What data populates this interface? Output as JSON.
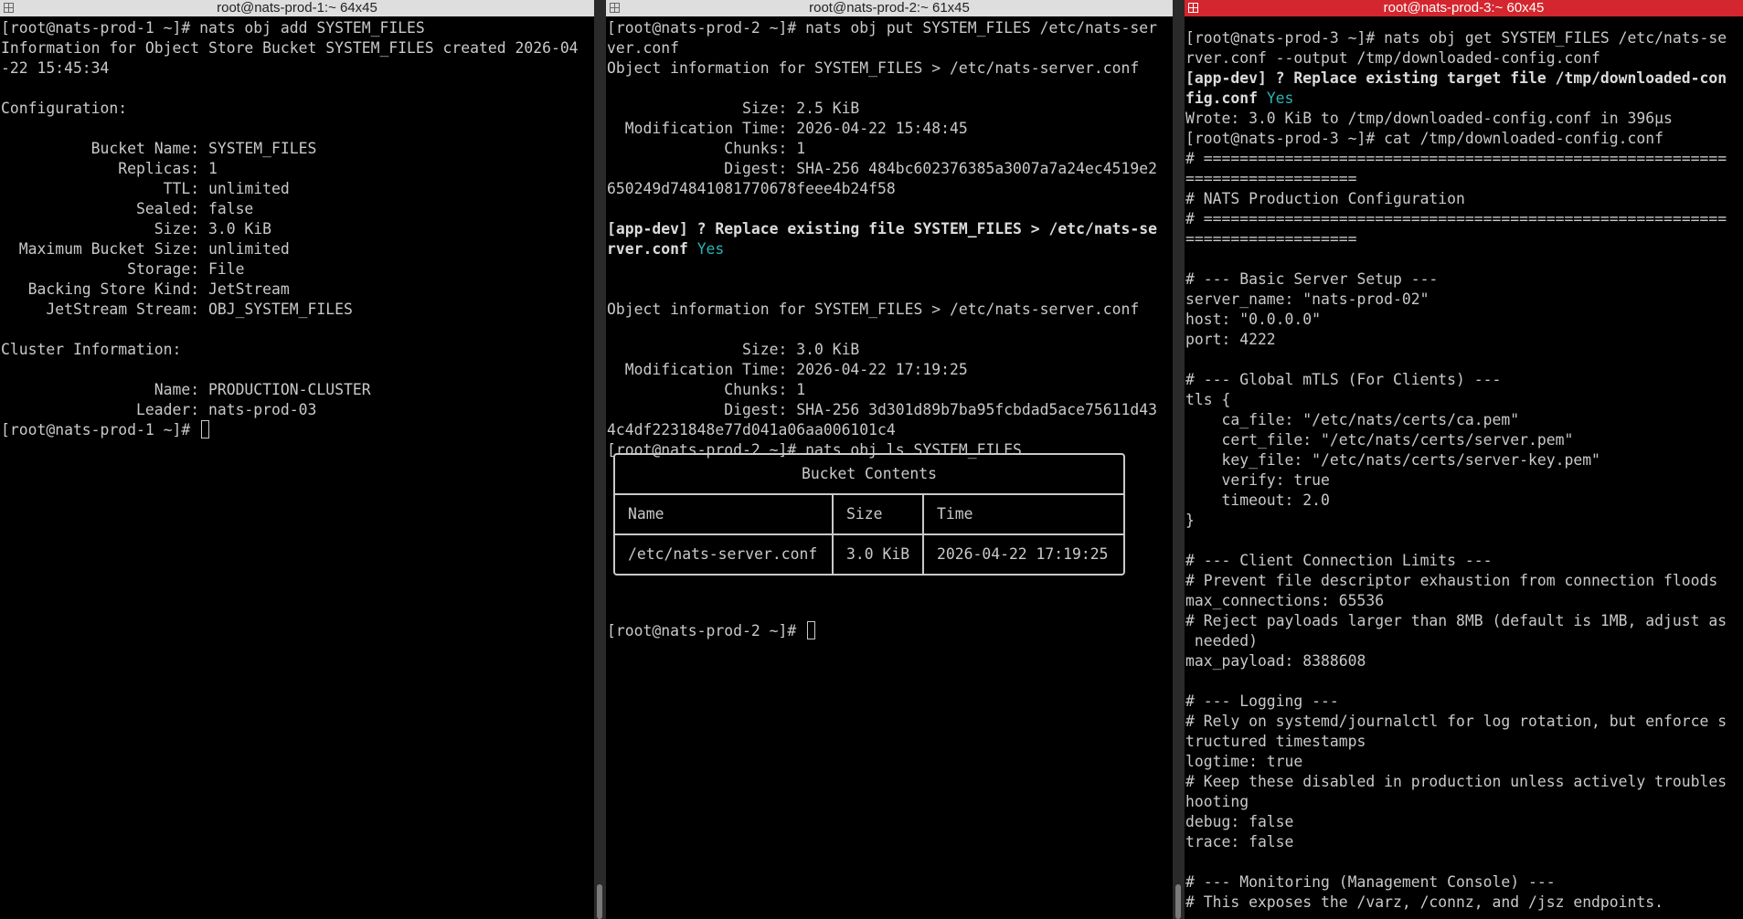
{
  "panes": [
    {
      "title": "root@nats-prod-1:~ 64x45",
      "lines": [
        "[root@nats-prod-1 ~]# nats obj add SYSTEM_FILES",
        "Information for Object Store Bucket SYSTEM_FILES created 2026-04",
        "-22 15:45:34",
        "",
        "Configuration:",
        "",
        "          Bucket Name: SYSTEM_FILES",
        "             Replicas: 1",
        "                  TTL: unlimited",
        "               Sealed: false",
        "                 Size: 3.0 KiB",
        "  Maximum Bucket Size: unlimited",
        "              Storage: File",
        "   Backing Store Kind: JetStream",
        "     JetStream Stream: OBJ_SYSTEM_FILES",
        "",
        "Cluster Information:",
        "",
        "                 Name: PRODUCTION-CLUSTER",
        "               Leader: nats-prod-03"
      ],
      "prompt": "[root@nats-prod-1 ~]# "
    },
    {
      "title": "root@nats-prod-2:~ 61x45",
      "lines": [
        "[root@nats-prod-2 ~]# nats obj put SYSTEM_FILES /etc/nats-ser",
        "ver.conf",
        "Object information for SYSTEM_FILES > /etc/nats-server.conf",
        "",
        "               Size: 2.5 KiB",
        "  Modification Time: 2026-04-22 15:48:45",
        "             Chunks: 1",
        "             Digest: SHA-256 484bc602376385a3007a7a24ec4519e2",
        "650249d74841081770678feee4b24f58",
        "",
        "[app-dev] ? Replace existing file SYSTEM_FILES > /etc/nats-se",
        "rver.conf ",
        "",
        "",
        "Object information for SYSTEM_FILES > /etc/nats-server.conf",
        "",
        "               Size: 3.0 KiB",
        "  Modification Time: 2026-04-22 17:19:25",
        "             Chunks: 1",
        "             Digest: SHA-256 3d301d89b7ba95fcbdad5ace75611d43",
        "4c4df2231848e77d041a06aa006101c4",
        "[root@nats-prod-2 ~]# nats obj ls SYSTEM_FILES"
      ],
      "answer": "Yes",
      "table": {
        "title": "Bucket Contents",
        "headers": [
          "Name",
          "Size",
          "Time"
        ],
        "rows": [
          [
            "/etc/nats-server.conf",
            "3.0 KiB",
            "2026-04-22 17:19:25"
          ]
        ]
      },
      "prompt": "[root@nats-prod-2 ~]# "
    },
    {
      "title": "root@nats-prod-3:~ 60x45",
      "answer": "Yes",
      "lines": [
        "[root@nats-prod-3 ~]# nats obj get SYSTEM_FILES /etc/nats-se",
        "rver.conf --output /tmp/downloaded-config.conf",
        "[app-dev] ? Replace existing target file /tmp/downloaded-con",
        "fig.conf ",
        "Wrote: 3.0 KiB to /tmp/downloaded-config.conf in 396µs",
        "[root@nats-prod-3 ~]# cat /tmp/downloaded-config.conf",
        "# ==========================================================",
        "===================",
        "# NATS Production Configuration",
        "# ==========================================================",
        "===================",
        "",
        "# --- Basic Server Setup ---",
        "server_name: \"nats-prod-02\"",
        "host: \"0.0.0.0\"",
        "port: 4222",
        "",
        "# --- Global mTLS (For Clients) ---",
        "tls {",
        "    ca_file: \"/etc/nats/certs/ca.pem\"",
        "    cert_file: \"/etc/nats/certs/server.pem\"",
        "    key_file: \"/etc/nats/certs/server-key.pem\"",
        "    verify: true",
        "    timeout: 2.0",
        "}",
        "",
        "# --- Client Connection Limits ---",
        "# Prevent file descriptor exhaustion from connection floods",
        "max_connections: 65536",
        "# Reject payloads larger than 8MB (default is 1MB, adjust as",
        " needed)",
        "max_payload: 8388608",
        "",
        "# --- Logging ---",
        "# Rely on systemd/journalctl for log rotation, but enforce s",
        "tructured timestamps",
        "logtime: true",
        "# Keep these disabled in production unless actively troubles",
        "hooting",
        "debug: false",
        "trace: false",
        "",
        "# --- Monitoring (Management Console) ---",
        "# This exposes the /varz, /connz, and /jsz endpoints."
      ]
    }
  ],
  "colors": {
    "active_title": "#d4262e",
    "accent": "#2bb3b3",
    "text": "#c9c9c9",
    "background": "#000000"
  }
}
